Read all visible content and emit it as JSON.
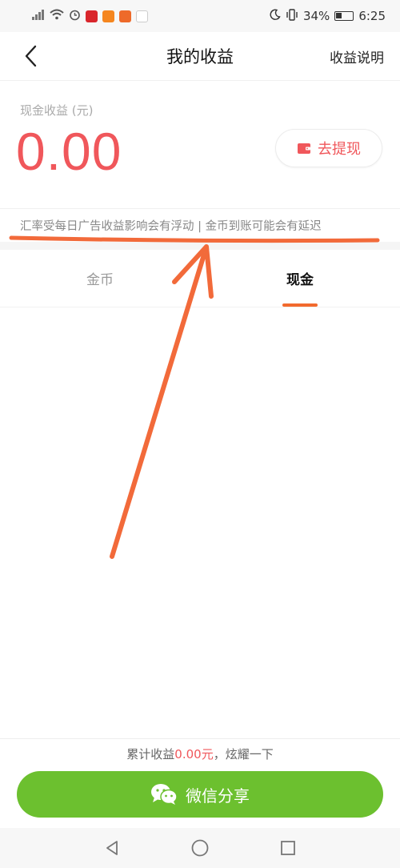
{
  "status_bar": {
    "battery": "34%",
    "time": "6:25"
  },
  "nav": {
    "title": "我的收益",
    "right_link": "收益说明"
  },
  "earnings": {
    "label": "现金收益 (元)",
    "amount": "0.00",
    "withdraw_label": "去提现"
  },
  "notice": "汇率受每日广告收益影响会有浮动 | 金币到账可能会有延迟",
  "tabs": [
    {
      "label": "金币",
      "active": false
    },
    {
      "label": "现金",
      "active": true
    }
  ],
  "footer": {
    "total_prefix": "累计收益",
    "total_amount": "0.00元",
    "total_suffix": "，炫耀一下",
    "share_label": "微信分享"
  },
  "colors": {
    "accent_red": "#f0575b",
    "tab_indicator": "#f26a2e",
    "wechat_green": "#6cc02f",
    "annotation": "#f26a3a"
  },
  "icons": {
    "back": "chevron-left-icon",
    "wallet": "wallet-icon",
    "wechat": "wechat-icon"
  }
}
